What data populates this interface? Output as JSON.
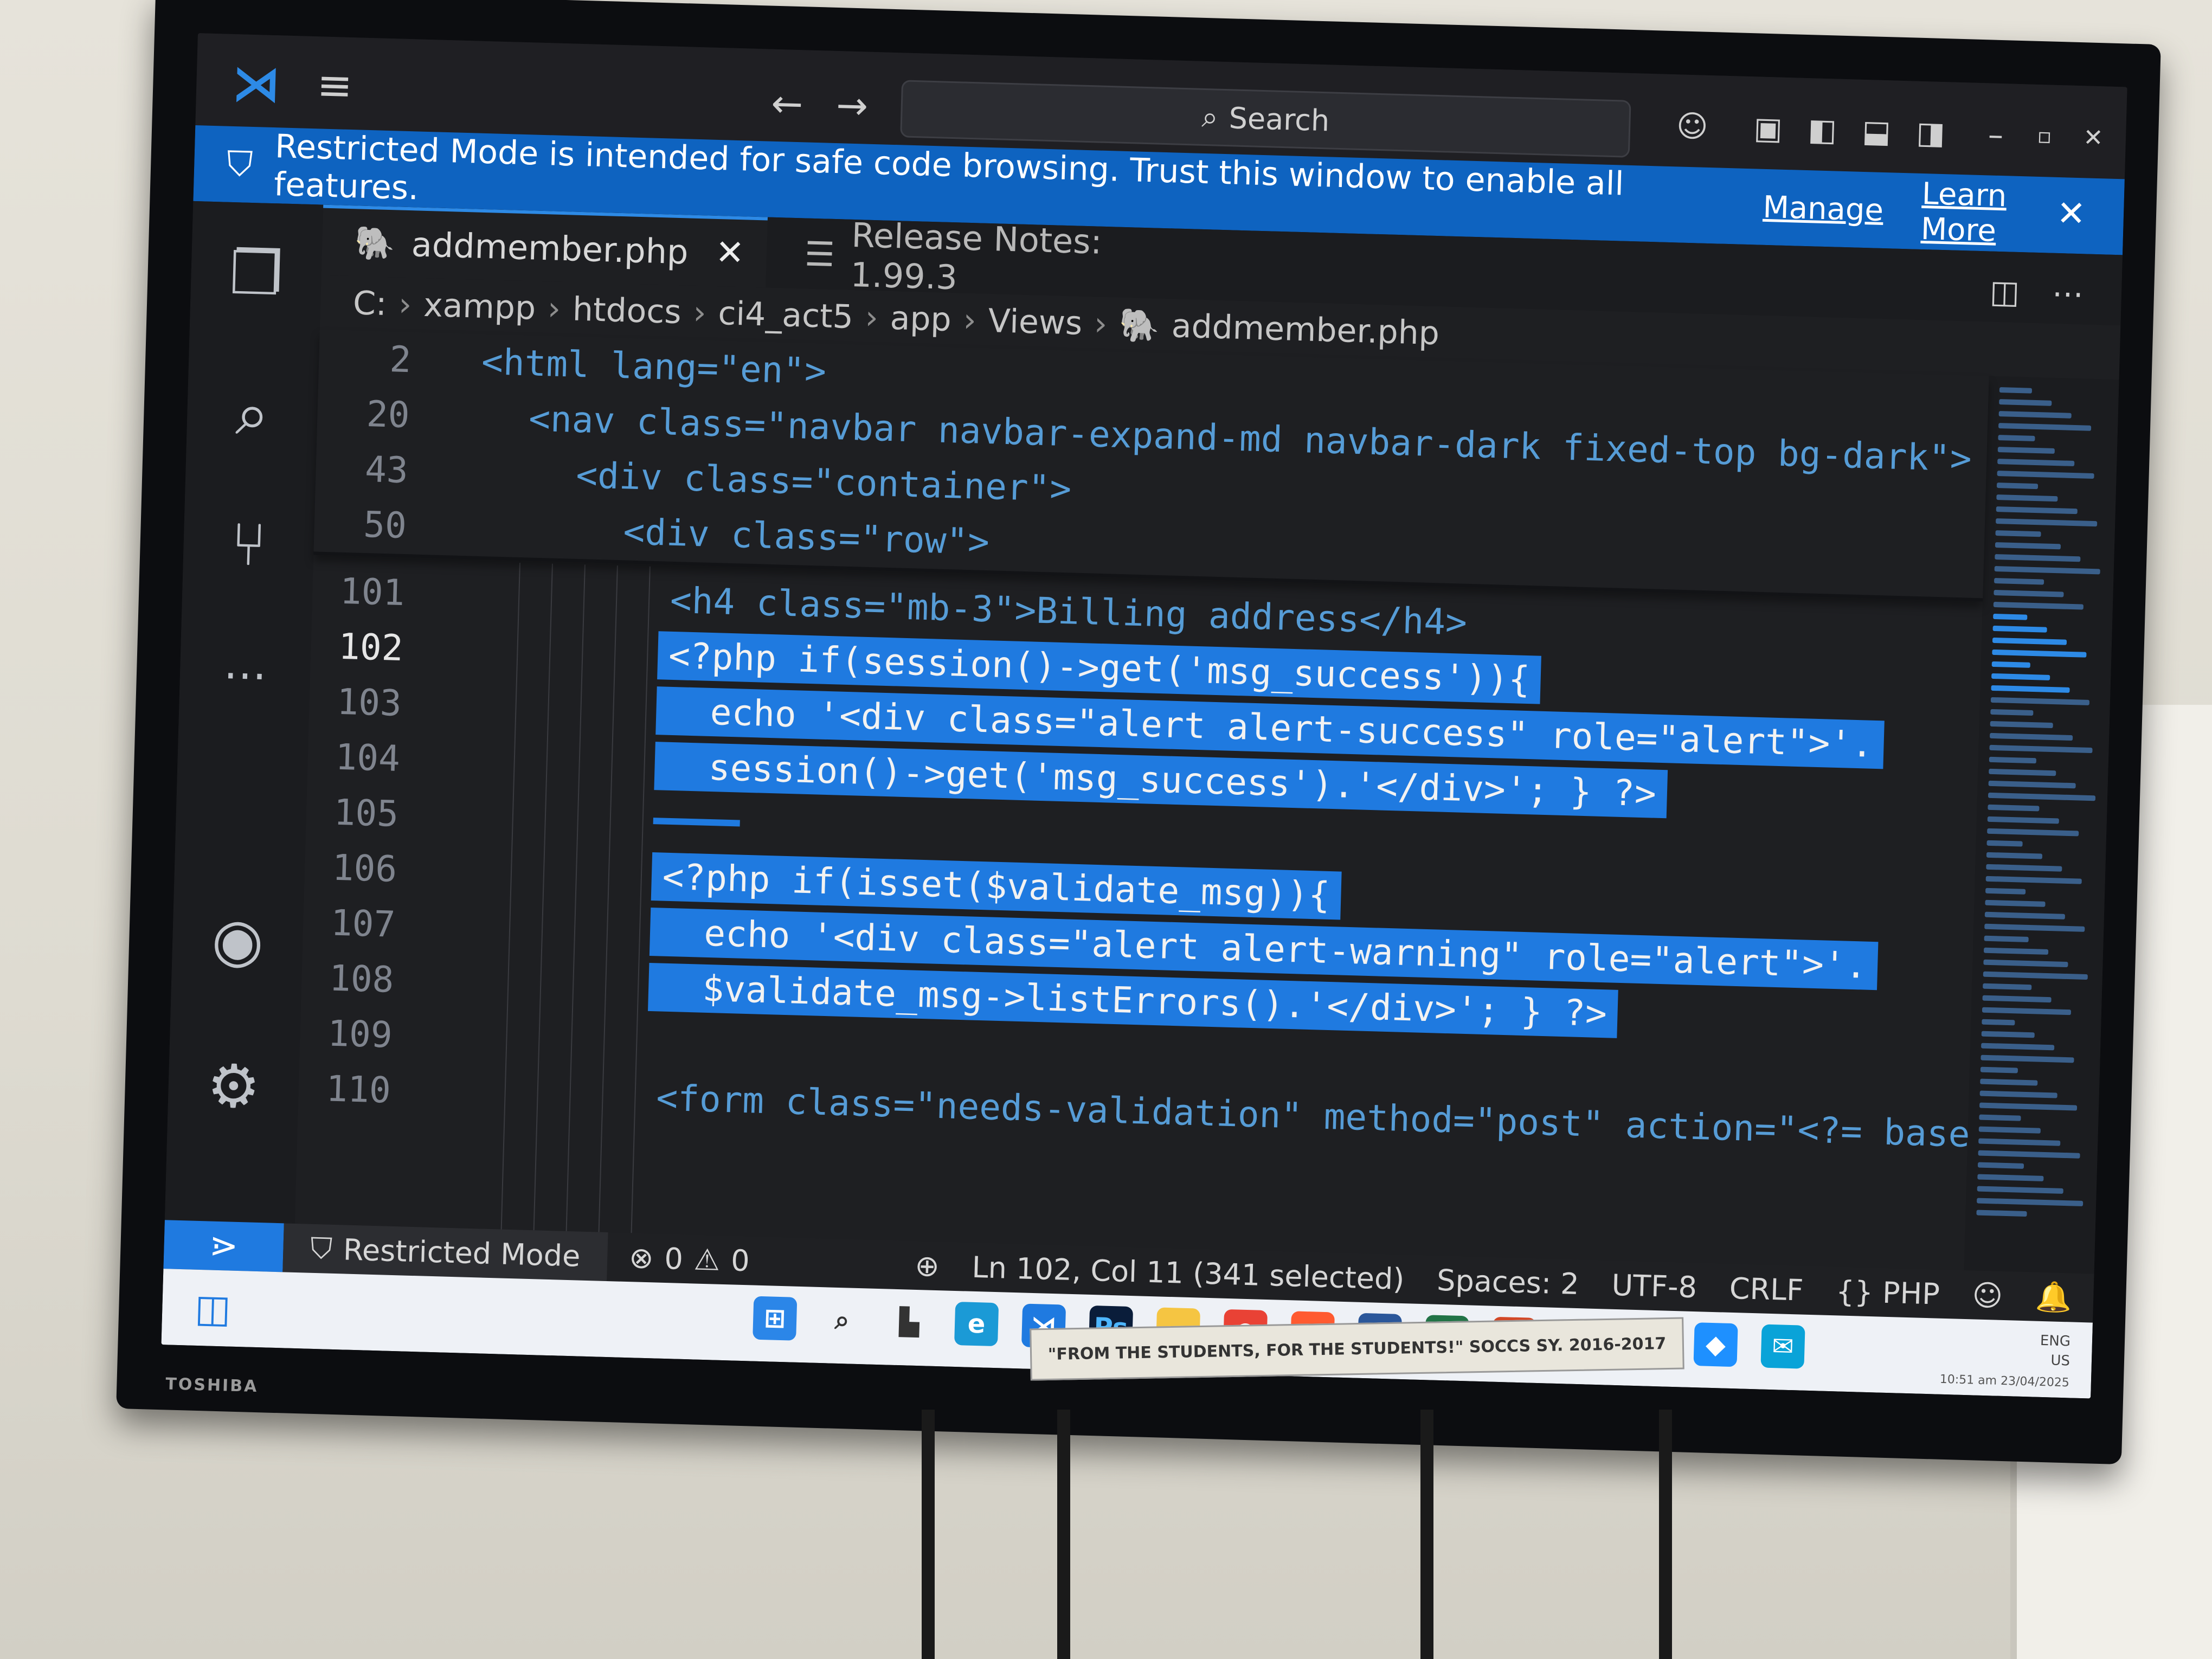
{
  "titlebar": {
    "search_label": "Search"
  },
  "banner": {
    "message": "Restricted Mode is intended for safe code browsing. Trust this window to enable all features.",
    "manage": "Manage",
    "learn_more": "Learn More"
  },
  "tabs": [
    {
      "label": "addmember.php",
      "active": true
    },
    {
      "label": "Release Notes: 1.99.3",
      "active": false
    }
  ],
  "breadcrumb": [
    "C:",
    "xampp",
    "htdocs",
    "ci4_act5",
    "app",
    "Views",
    "addmember.php"
  ],
  "sticky_lines": [
    {
      "ln": "2",
      "indent": 0,
      "code": "<html lang=\"en\">"
    },
    {
      "ln": "20",
      "indent": 1,
      "code": "<nav class=\"navbar navbar-expand-md navbar-dark fixed-top bg-dark\">"
    },
    {
      "ln": "43",
      "indent": 2,
      "code": "<div class=\"container\">"
    },
    {
      "ln": "50",
      "indent": 3,
      "code": "<div class=\"row\">"
    }
  ],
  "code_lines": [
    {
      "ln": "101",
      "code": "<h4 class=\"mb-3\">Billing address</h4>"
    },
    {
      "ln": "102",
      "code": "<?php if(session()->get('msg_success')){"
    },
    {
      "ln": "103",
      "code": "  echo '<div class=\"alert alert-success\" role=\"alert\">'."
    },
    {
      "ln": "104",
      "code": "  session()->get('msg_success').'</div>'; } ?>"
    },
    {
      "ln": "105",
      "code": ""
    },
    {
      "ln": "106",
      "code": "<?php if(isset($validate_msg)){"
    },
    {
      "ln": "107",
      "code": "  echo '<div class=\"alert alert-warning\" role=\"alert\">'."
    },
    {
      "ln": "108",
      "code": "  $validate_msg->listErrors().'</div>'; } ?>"
    },
    {
      "ln": "109",
      "code": ""
    },
    {
      "ln": "110",
      "code": "<form class=\"needs-validation\" method=\"post\" action=\"<?= base_url();"
    }
  ],
  "status": {
    "restricted": "Restricted Mode",
    "errors": "0",
    "warnings": "0",
    "position": "Ln 102, Col 11 (341 selected)",
    "spaces": "Spaces: 2",
    "encoding": "UTF-8",
    "eol": "CRLF",
    "language": "PHP"
  },
  "taskbar": {
    "lang_top": "ENG",
    "lang_bottom": "US",
    "time": "10:51 am",
    "date": "23/04/2025"
  },
  "plaque": "\"FROM THE STUDENTS, FOR THE STUDENTS!\" SOCCS SY. 2016-2017",
  "brand": "TOSHIBA",
  "colors": {
    "accent": "#1f7ae0",
    "banner": "#0e63c0",
    "editor_bg": "#1e1f22"
  }
}
